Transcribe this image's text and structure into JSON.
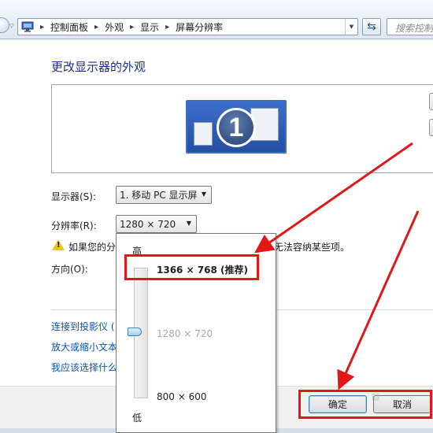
{
  "address_bar": {
    "breadcrumbs": [
      "控制面板",
      "外观",
      "显示",
      "屏幕分辨率"
    ],
    "search_placeholder": "搜索控制"
  },
  "page": {
    "title": "更改显示器的外观",
    "monitor_number": "1"
  },
  "settings": {
    "display_label": "显示器(S):",
    "display_value": "1. 移动 PC 显示屏",
    "resolution_label": "分辨率(R):",
    "resolution_value": "1280 × 720",
    "warning_left": "如果您的分",
    "warning_right": "无法容纳某些项。",
    "orientation_label": "方向(O):"
  },
  "links": {
    "projector": "连接到投影仪 (",
    "text_size": "放大或缩小文本",
    "which_settings": "我应该选择什么"
  },
  "footer": {
    "ok_label": "确定",
    "cancel_label": "取消"
  },
  "resolution_dropdown": {
    "high_label": "高",
    "low_label": "低",
    "options": [
      "1366 × 768 (推荐)",
      "1280 × 720",
      "800 × 600"
    ],
    "selected_option": "1280 × 720",
    "slider_level": 0.5
  },
  "annotation_color": "#e21717"
}
